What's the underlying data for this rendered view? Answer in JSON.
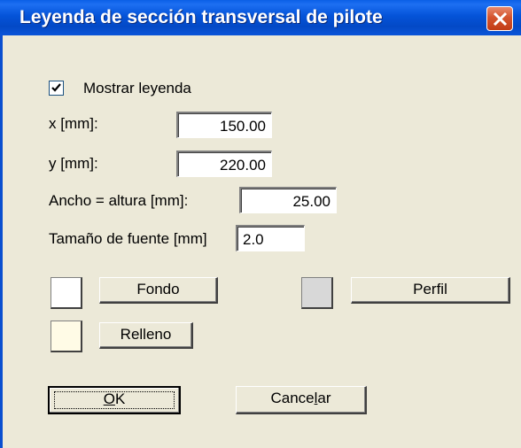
{
  "window": {
    "title": "Leyenda de sección transversal de pilote",
    "close_icon": "close-icon",
    "titlebar_color": "#0453d8",
    "close_color": "#d4542e"
  },
  "form": {
    "show_legend": {
      "label": "Mostrar leyenda",
      "checked": true
    },
    "x": {
      "label": "x [mm]:",
      "value": "150.00"
    },
    "y": {
      "label": "y [mm]:",
      "value": "220.00"
    },
    "width_height": {
      "label": "Ancho = altura [mm]:",
      "value": "25.00"
    },
    "font_size": {
      "label": "Tamaño de fuente [mm]",
      "value": "2.0"
    }
  },
  "colors": {
    "fondo": {
      "label": "Fondo",
      "swatch": "#ffffff"
    },
    "perfil": {
      "label": "Perfil",
      "swatch": "#d8d8d8"
    },
    "relleno": {
      "label": "Relleno",
      "swatch": "#fffbe6"
    }
  },
  "buttons": {
    "ok": {
      "mnemonic": "O",
      "rest": "K"
    },
    "cancel": {
      "pre": "Cance",
      "mnemonic": "l",
      "post": "ar"
    }
  }
}
